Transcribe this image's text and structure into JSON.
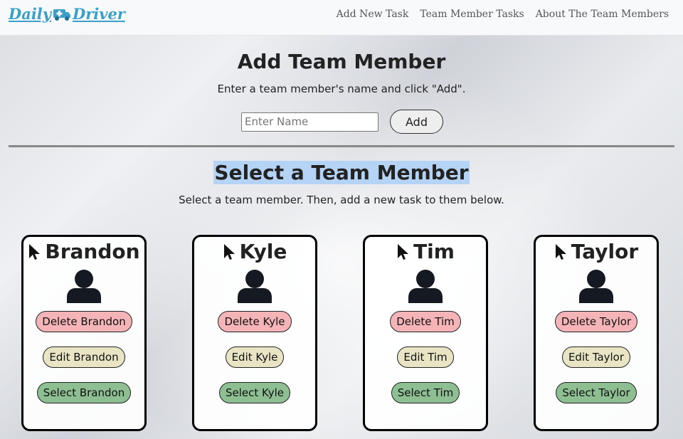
{
  "nav": {
    "brand_left": "Daily",
    "brand_right": "Driver",
    "links": [
      "Add New Task",
      "Team Member Tasks",
      "About The Team Members"
    ]
  },
  "add_section": {
    "title": "Add Team Member",
    "instructions": "Enter a team member's name and click \"Add\".",
    "input_placeholder": "Enter Name",
    "input_value": "",
    "add_label": "Add"
  },
  "select_section": {
    "title": "Select a Team Member",
    "instructions": "Select a team member. Then, add a new task to them below."
  },
  "members": [
    {
      "name": "Brandon",
      "delete": "Delete Brandon",
      "edit": "Edit Brandon",
      "select": "Select Brandon"
    },
    {
      "name": "Kyle",
      "delete": "Delete Kyle",
      "edit": "Edit Kyle",
      "select": "Select Kyle"
    },
    {
      "name": "Tim",
      "delete": "Delete Tim",
      "edit": "Edit Tim",
      "select": "Select Tim"
    },
    {
      "name": "Taylor",
      "delete": "Delete Taylor",
      "edit": "Edit Taylor",
      "select": "Select Taylor"
    }
  ],
  "colors": {
    "brand": "#3aa0c8",
    "delete": "#f5b5b8",
    "edit": "#e8e4c4",
    "select": "#8dbf92",
    "highlight": "#b5d3f5"
  },
  "icons": {
    "brand": "ambulance-icon",
    "cursor": "pointer-cursor-icon",
    "avatar": "user-silhouette-icon"
  }
}
